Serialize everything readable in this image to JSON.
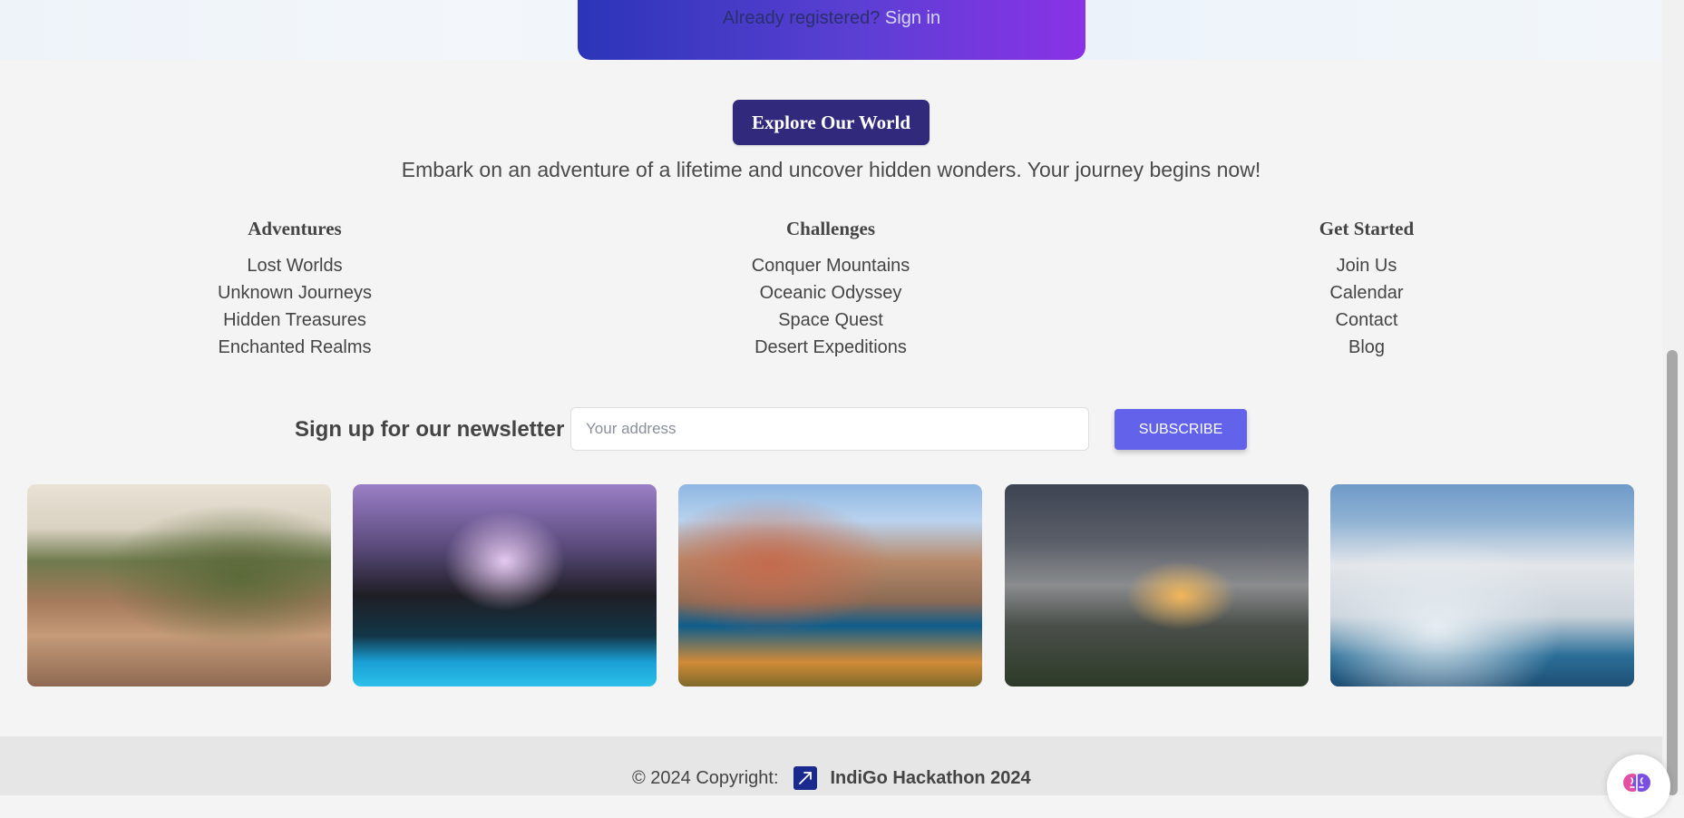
{
  "hero": {
    "already_text": "Already registered?",
    "signin_label": "Sign in"
  },
  "explore": {
    "button_label": "Explore Our World"
  },
  "tagline": "Embark on an adventure of a lifetime and uncover hidden wonders. Your journey begins now!",
  "columns": [
    {
      "title": "Adventures",
      "links": [
        "Lost Worlds",
        "Unknown Journeys",
        "Hidden Treasures",
        "Enchanted Realms"
      ]
    },
    {
      "title": "Challenges",
      "links": [
        "Conquer Mountains",
        "Oceanic Odyssey",
        "Space Quest",
        "Desert Expeditions"
      ]
    },
    {
      "title": "Get Started",
      "links": [
        "Join Us",
        "Calendar",
        "Contact",
        "Blog"
      ]
    }
  ],
  "newsletter": {
    "label": "Sign up for our newsletter",
    "placeholder": "Your address",
    "value": "",
    "button_label": "SUBSCRIBE"
  },
  "footer": {
    "copyright": "© 2024 Copyright:",
    "brand": "IndiGo Hackathon 2024"
  },
  "colors": {
    "primary_button": "#312a7c",
    "subscribe_button": "#6262ea",
    "signin_gradient_start": "#2b35b8",
    "signin_gradient_end": "#8a32e6",
    "brand_logo": "#1b2a8f"
  },
  "icons": {
    "brand_logo": "plane-arrow-icon",
    "assistant": "brain-icon"
  }
}
